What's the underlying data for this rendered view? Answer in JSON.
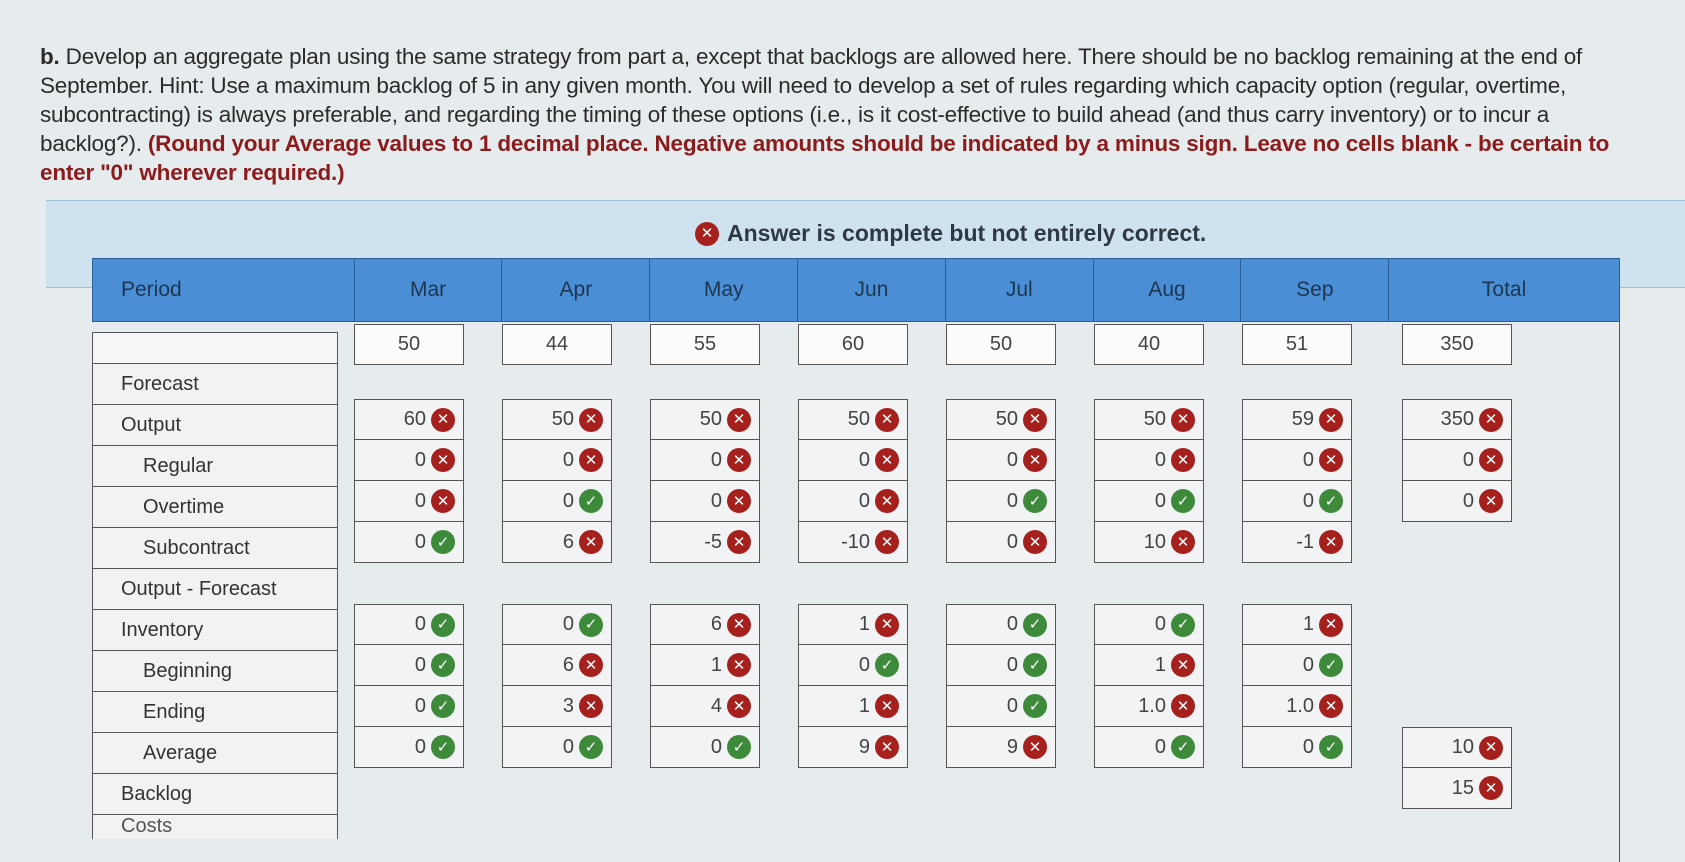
{
  "question": {
    "lead": "b.",
    "body": "Develop an aggregate plan using the same strategy from part a, except that backlogs are allowed here. There should be no backlog remaining at the end of September. Hint: Use a maximum backlog of 5 in any given month. You will need to develop a set of rules regarding which capacity option (regular, overtime, subcontracting) is always preferable, and regarding the timing of these options (i.e., is it cost-effective to build ahead (and thus carry inventory) or to incur a backlog?).",
    "instruction": "(Round your Average values to 1 decimal place. Negative amounts should be indicated by a minus sign. Leave no cells blank - be certain to enter \"0\" wherever required.)"
  },
  "banner": {
    "status_icon": "x-circle-icon",
    "message": "Answer is complete but not entirely correct."
  },
  "colors": {
    "header_blue": "#4a8fd6",
    "banner_blue": "#cfe2f0",
    "incorrect_red": "#a6211e",
    "correct_green": "#3d8a3a",
    "instruction_red": "#8c1c1c"
  },
  "table": {
    "headers": [
      "Period",
      "Mar",
      "Apr",
      "May",
      "Jun",
      "Jul",
      "Aug",
      "Sep",
      "Total"
    ],
    "row_labels": {
      "forecast": "Forecast",
      "output": "Output",
      "regular": "Regular",
      "overtime": "Overtime",
      "subcontract": "Subcontract",
      "output_minus_forecast": "Output - Forecast",
      "inventory": "Inventory",
      "beginning": "Beginning",
      "ending": "Ending",
      "average": "Average",
      "backlog": "Backlog",
      "costs": "Costs"
    },
    "forecast": [
      "50",
      "44",
      "55",
      "60",
      "50",
      "40",
      "51",
      "350"
    ],
    "months": [
      {
        "name": "Mar",
        "regular": {
          "value": "60",
          "status": "incorrect"
        },
        "overtime": {
          "value": "0",
          "status": "incorrect"
        },
        "subcontract": {
          "value": "0",
          "status": "incorrect"
        },
        "output_minus_forecast": {
          "value": "0",
          "status": "correct"
        },
        "beginning": {
          "value": "0",
          "status": "correct"
        },
        "ending": {
          "value": "0",
          "status": "correct"
        },
        "average": {
          "value": "0",
          "status": "correct"
        },
        "backlog": {
          "value": "0",
          "status": "correct"
        }
      },
      {
        "name": "Apr",
        "regular": {
          "value": "50",
          "status": "incorrect"
        },
        "overtime": {
          "value": "0",
          "status": "incorrect"
        },
        "subcontract": {
          "value": "0",
          "status": "correct"
        },
        "output_minus_forecast": {
          "value": "6",
          "status": "incorrect"
        },
        "beginning": {
          "value": "0",
          "status": "correct"
        },
        "ending": {
          "value": "6",
          "status": "incorrect"
        },
        "average": {
          "value": "3",
          "status": "incorrect"
        },
        "backlog": {
          "value": "0",
          "status": "correct"
        }
      },
      {
        "name": "May",
        "regular": {
          "value": "50",
          "status": "incorrect"
        },
        "overtime": {
          "value": "0",
          "status": "incorrect"
        },
        "subcontract": {
          "value": "0",
          "status": "incorrect"
        },
        "output_minus_forecast": {
          "value": "-5",
          "status": "incorrect"
        },
        "beginning": {
          "value": "6",
          "status": "incorrect"
        },
        "ending": {
          "value": "1",
          "status": "incorrect"
        },
        "average": {
          "value": "4",
          "status": "incorrect"
        },
        "backlog": {
          "value": "0",
          "status": "correct"
        }
      },
      {
        "name": "Jun",
        "regular": {
          "value": "50",
          "status": "incorrect"
        },
        "overtime": {
          "value": "0",
          "status": "incorrect"
        },
        "subcontract": {
          "value": "0",
          "status": "incorrect"
        },
        "output_minus_forecast": {
          "value": "-10",
          "status": "incorrect"
        },
        "beginning": {
          "value": "1",
          "status": "incorrect"
        },
        "ending": {
          "value": "0",
          "status": "correct"
        },
        "average": {
          "value": "1",
          "status": "incorrect"
        },
        "backlog": {
          "value": "9",
          "status": "incorrect"
        }
      },
      {
        "name": "Jul",
        "regular": {
          "value": "50",
          "status": "incorrect"
        },
        "overtime": {
          "value": "0",
          "status": "incorrect"
        },
        "subcontract": {
          "value": "0",
          "status": "correct"
        },
        "output_minus_forecast": {
          "value": "0",
          "status": "incorrect"
        },
        "beginning": {
          "value": "0",
          "status": "correct"
        },
        "ending": {
          "value": "0",
          "status": "correct"
        },
        "average": {
          "value": "0",
          "status": "correct"
        },
        "backlog": {
          "value": "9",
          "status": "incorrect"
        }
      },
      {
        "name": "Aug",
        "regular": {
          "value": "50",
          "status": "incorrect"
        },
        "overtime": {
          "value": "0",
          "status": "incorrect"
        },
        "subcontract": {
          "value": "0",
          "status": "correct"
        },
        "output_minus_forecast": {
          "value": "10",
          "status": "incorrect"
        },
        "beginning": {
          "value": "0",
          "status": "correct"
        },
        "ending": {
          "value": "1",
          "status": "incorrect"
        },
        "average": {
          "value": "1.0",
          "status": "incorrect"
        },
        "backlog": {
          "value": "0",
          "status": "correct"
        }
      },
      {
        "name": "Sep",
        "regular": {
          "value": "59",
          "status": "incorrect"
        },
        "overtime": {
          "value": "0",
          "status": "incorrect"
        },
        "subcontract": {
          "value": "0",
          "status": "correct"
        },
        "output_minus_forecast": {
          "value": "-1",
          "status": "incorrect"
        },
        "beginning": {
          "value": "1",
          "status": "incorrect"
        },
        "ending": {
          "value": "0",
          "status": "correct"
        },
        "average": {
          "value": "1.0",
          "status": "incorrect"
        },
        "backlog": {
          "value": "0",
          "status": "correct"
        }
      }
    ],
    "totals": {
      "regular": {
        "value": "350",
        "status": "incorrect"
      },
      "overtime": {
        "value": "0",
        "status": "incorrect"
      },
      "subcontract": {
        "value": "0",
        "status": "incorrect"
      },
      "average": {
        "value": "10",
        "status": "incorrect"
      },
      "backlog": {
        "value": "15",
        "status": "incorrect"
      }
    }
  }
}
